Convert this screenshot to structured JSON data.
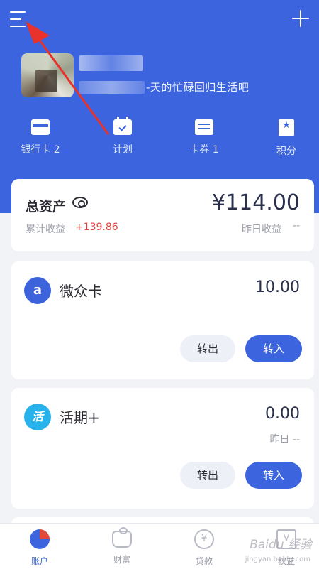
{
  "header": {
    "slogan": "-天的忙碌回归生活吧",
    "quick_links": [
      {
        "label": "银行卡 2",
        "icon": "bank-card-icon"
      },
      {
        "label": "计划",
        "icon": "calendar-check-icon"
      },
      {
        "label": "卡券 1",
        "icon": "coupon-icon"
      },
      {
        "label": "积分",
        "icon": "points-star-icon"
      }
    ],
    "colors": {
      "brand": "#3b64de",
      "annotation_arrow": "#e8322b"
    }
  },
  "assets": {
    "title": "总资产",
    "amount": "¥114.00",
    "cumulative_label": "累计收益",
    "cumulative_value": "+139.86",
    "yesterday_label": "昨日收益",
    "yesterday_value": "--"
  },
  "products": [
    {
      "icon_text": "a",
      "name": "微众卡",
      "value": "10.00",
      "sub": "",
      "out_label": "转出",
      "in_label": "转入"
    },
    {
      "icon_text": "活",
      "name": "活期+",
      "value": "0.00",
      "sub": "昨日 --",
      "out_label": "转出",
      "in_label": "转入"
    }
  ],
  "tabbar": {
    "tabs": [
      {
        "label": "账户",
        "icon": "pie-chart-icon",
        "active": true
      },
      {
        "label": "财富",
        "icon": "money-bag-icon",
        "active": false
      },
      {
        "label": "贷款",
        "icon": "yen-coin-icon",
        "active": false
      },
      {
        "label": "权益",
        "icon": "gift-box-icon",
        "active": false
      }
    ]
  },
  "watermark": {
    "text": "Baidu 经验",
    "sub": "jingyan.baidu.com"
  }
}
